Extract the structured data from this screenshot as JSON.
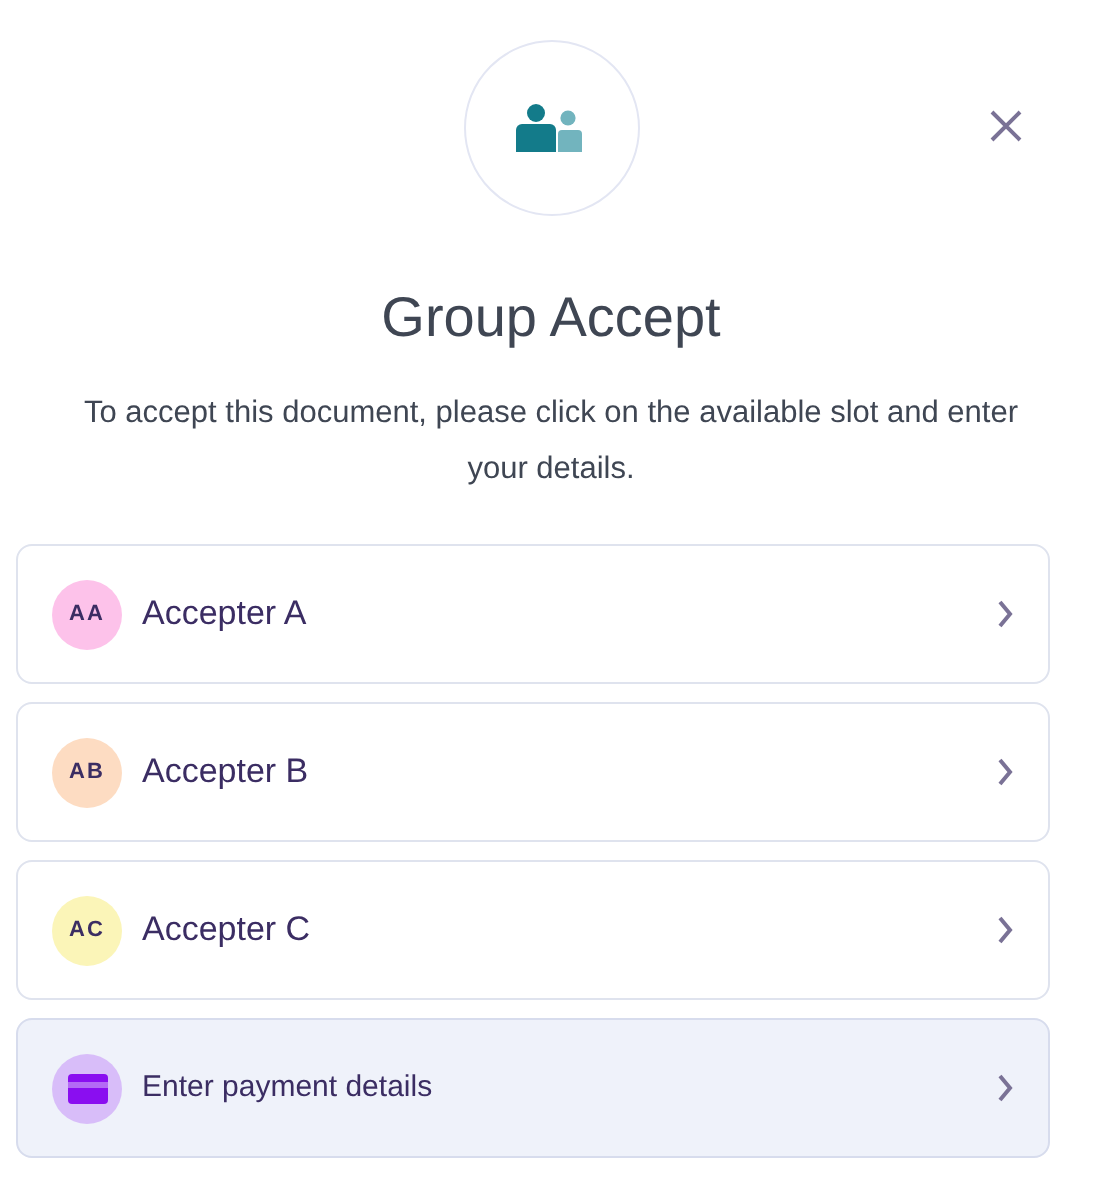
{
  "title": "Group Accept",
  "description": "To accept this document, please click on the available slot and enter your details.",
  "slots": [
    {
      "kind": "accepter",
      "initials": "AA",
      "label": "Accepter A",
      "color": "#fdc2ea"
    },
    {
      "kind": "accepter",
      "initials": "AB",
      "label": "Accepter B",
      "color": "#fddcc2"
    },
    {
      "kind": "accepter",
      "initials": "AC",
      "label": "Accepter C",
      "color": "#fbf5b8"
    },
    {
      "kind": "payment",
      "label": "Enter payment details",
      "color": "#d8bdf9"
    }
  ]
}
